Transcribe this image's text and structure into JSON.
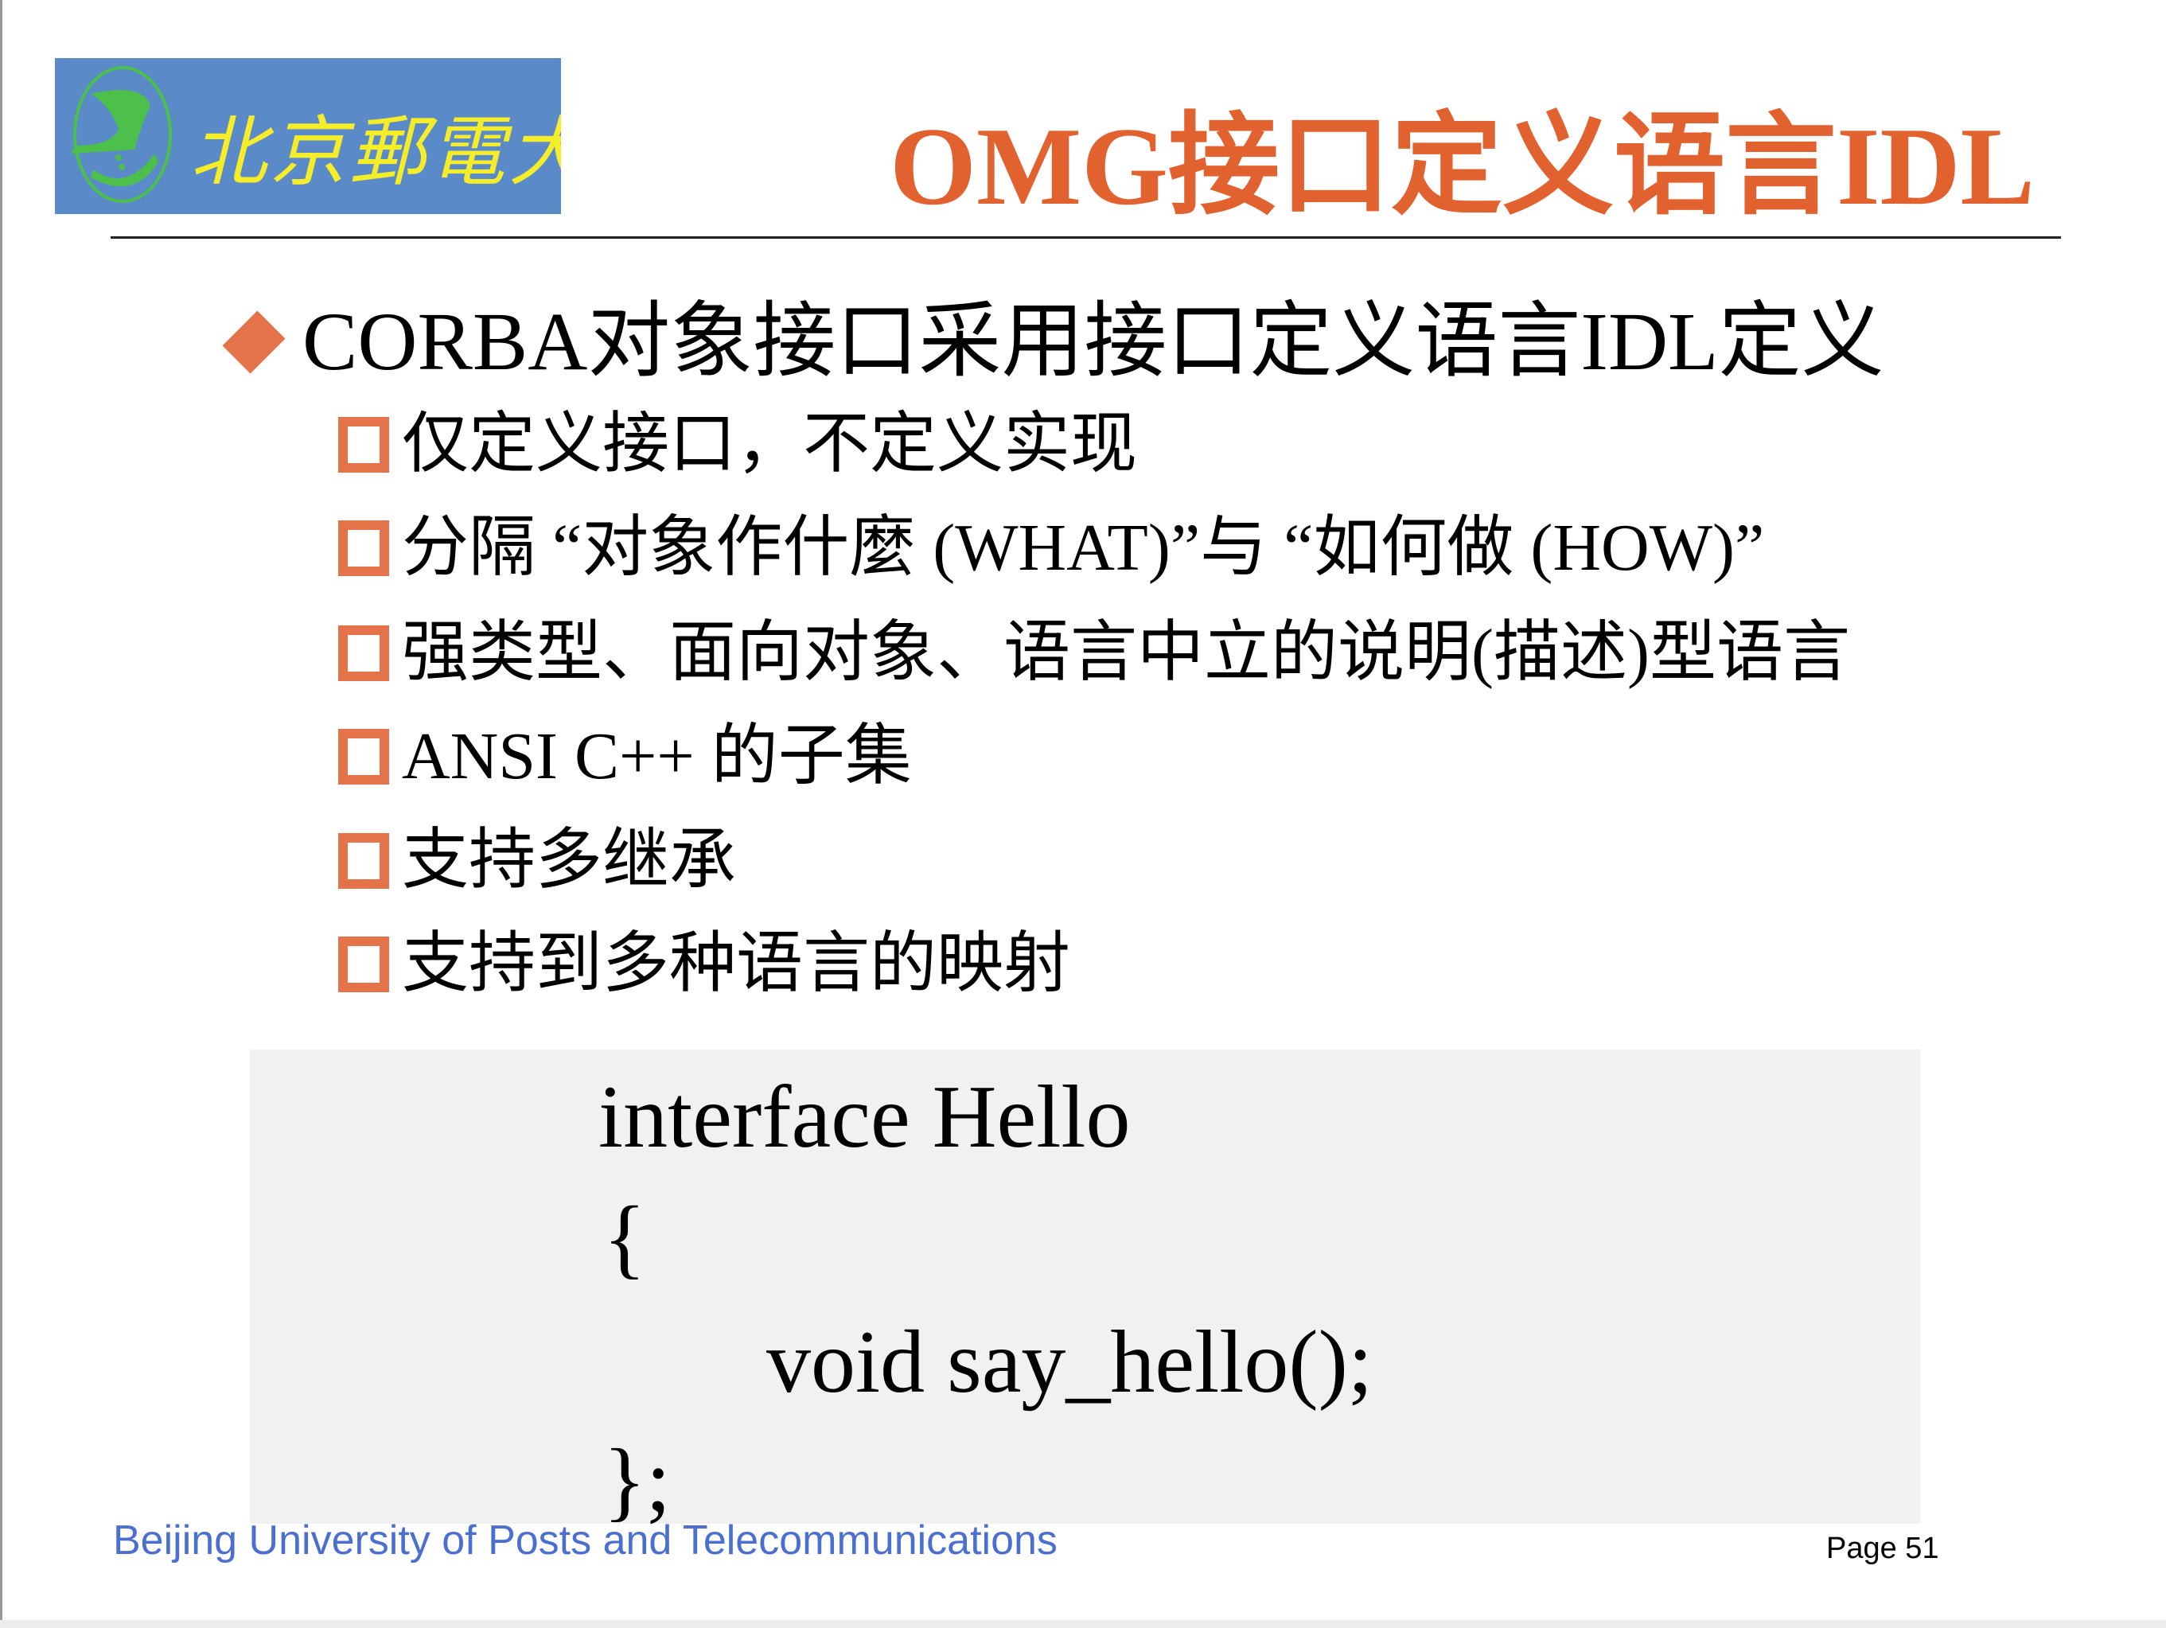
{
  "logo": {
    "text": "北京郵電大學",
    "colors": {
      "background": "#5a8ac8",
      "emblem": "#4cc04a",
      "text": "#f5ec2a"
    }
  },
  "title": "OMG接口定义语言IDL",
  "main_point": "CORBA对象接口采用接口定义语言IDL定义",
  "sub_points": [
    "仅定义接口，不定义实现",
    "分隔 “对象作什麼 (WHAT)”与 “如何做 (HOW)”",
    "强类型、面向对象、语言中立的说明(描述)型语言",
    "ANSI C++ 的子集",
    "支持多继承",
    "支持到多种语言的映射"
  ],
  "code": {
    "lines": [
      "interface Hello",
      "{",
      "void say_hello();",
      "};"
    ]
  },
  "footer": {
    "institution": "Beijing University of Posts and Telecommunications",
    "page": "Page 51"
  },
  "colors": {
    "accent": "#e2622f",
    "bullet": "#e5734a",
    "footer_text": "#4a6fd0",
    "code_bg": "#f1f1f1"
  }
}
